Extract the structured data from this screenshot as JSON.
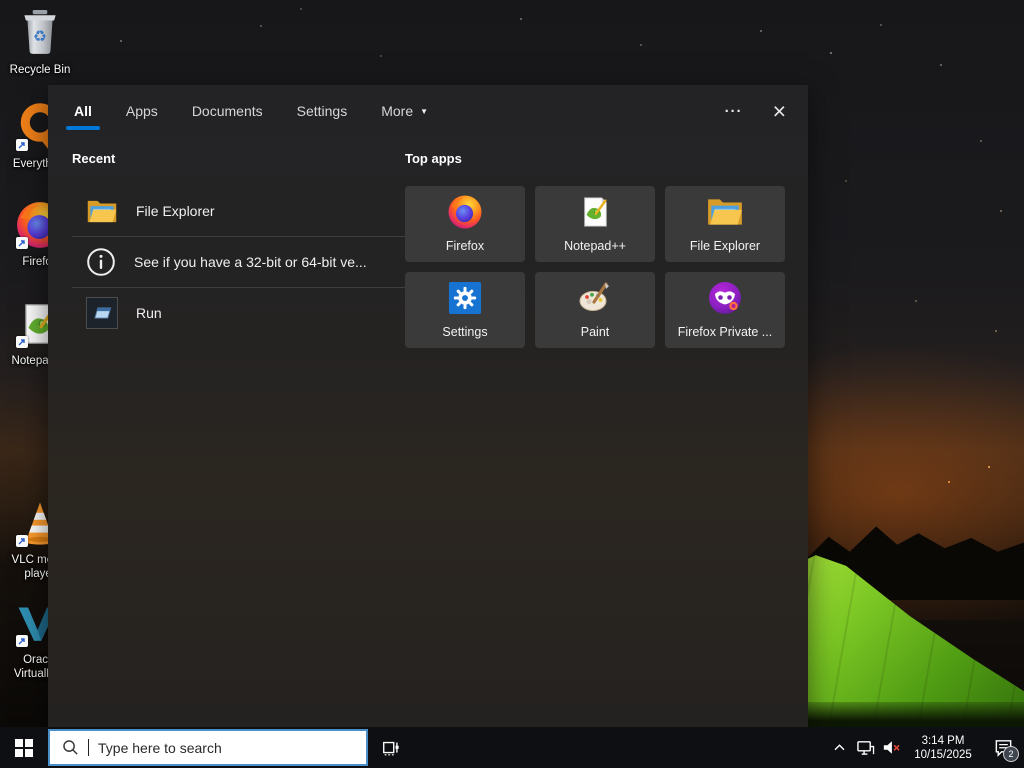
{
  "desktop": {
    "icons": [
      {
        "label": "Recycle Bin"
      },
      {
        "label": "Everything"
      },
      {
        "label": "Firefox"
      },
      {
        "label": "Notepad++"
      },
      {
        "label": "VLC media player"
      },
      {
        "label": "Oracle VirtualBox"
      }
    ]
  },
  "search_panel": {
    "tabs": [
      {
        "label": "All"
      },
      {
        "label": "Apps"
      },
      {
        "label": "Documents"
      },
      {
        "label": "Settings"
      },
      {
        "label": "More"
      }
    ],
    "more_arrow": "▼",
    "actions": {
      "more_options": "···",
      "close": "×"
    },
    "recent": {
      "header": "Recent",
      "items": [
        {
          "label": "File Explorer",
          "icon": "folder-icon"
        },
        {
          "label": "See if you have a 32-bit or 64-bit ve...",
          "icon": "info-icon"
        },
        {
          "label": "Run",
          "icon": "run-icon"
        }
      ]
    },
    "top_apps": {
      "header": "Top apps",
      "items": [
        {
          "label": "Firefox",
          "icon": "firefox-icon"
        },
        {
          "label": "Notepad++",
          "icon": "notepadpp-icon"
        },
        {
          "label": "File Explorer",
          "icon": "folder-icon"
        },
        {
          "label": "Settings",
          "icon": "settings-icon"
        },
        {
          "label": "Paint",
          "icon": "paint-icon"
        },
        {
          "label": "Firefox Private ...",
          "icon": "firefox-private-icon"
        }
      ]
    }
  },
  "taskbar": {
    "search": {
      "placeholder": "Type here to search"
    },
    "clock": {
      "time": "3:14 PM",
      "date": "10/15/2025"
    },
    "notifications": {
      "count": "2"
    }
  },
  "glyphs": {
    "recycle": "♻"
  },
  "colors": {
    "accent": "#0078d7",
    "search_border": "#4a90c8",
    "panel_bg": "#242322",
    "card_bg": "#3a3a3a",
    "taskbar_bg": "#0e0f12",
    "tent_green": "#7cc724"
  }
}
